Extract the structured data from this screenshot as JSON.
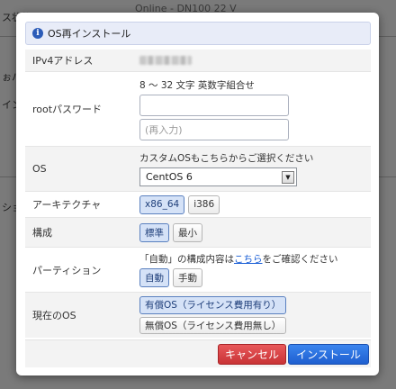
{
  "background": {
    "fragments": [
      "ス状態",
      "Online - DN100 22 V",
      "ぉパ",
      "イン",
      "ション"
    ]
  },
  "dialog": {
    "title": "OS再インストール"
  },
  "form": {
    "ipv4": {
      "label": "IPv4アドレス"
    },
    "root_password": {
      "label": "rootパスワード",
      "hint": "8 ～ 32 文字 英数字組合せ",
      "input_value": "",
      "confirm_placeholder": "(再入力)"
    },
    "os": {
      "label": "OS",
      "hint": "カスタムOSもこちらからご選択ください",
      "selected": "CentOS 6"
    },
    "architecture": {
      "label": "アーキテクチャ",
      "options": [
        "x86_64",
        "i386"
      ],
      "selected_index": 0
    },
    "composition": {
      "label": "構成",
      "options": [
        "標準",
        "最小"
      ],
      "selected_index": 0
    },
    "partition": {
      "label": "パーティション",
      "hint_before": "「自動」の構成内容は",
      "hint_link": "こちら",
      "hint_after": "をご確認ください",
      "options": [
        "自動",
        "手動"
      ],
      "selected_index": 0
    },
    "current_os": {
      "label": "現在のOS",
      "options": [
        "有償OS（ライセンス費用有り）",
        "無償OS（ライセンス費用無し）"
      ],
      "selected_index": 0
    }
  },
  "footer": {
    "cancel_label": "キャンセル",
    "install_label": "インストール"
  },
  "colors": {
    "cancel": "#d6393c",
    "install": "#2b72e3",
    "selected_option": "#d5e2f7"
  }
}
